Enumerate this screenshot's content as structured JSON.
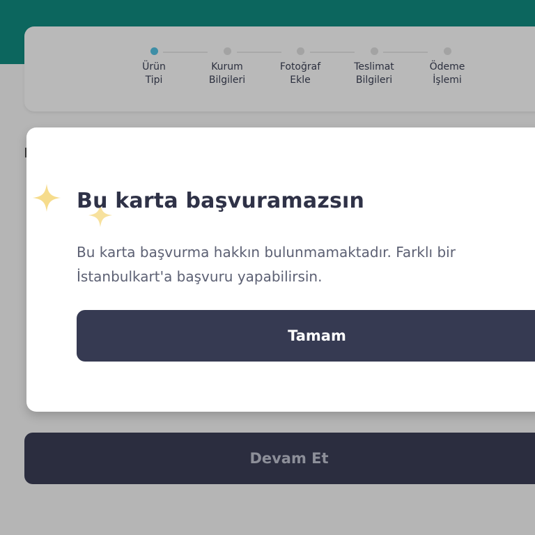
{
  "stepper": {
    "steps": [
      {
        "label": "Ürün\nTipi",
        "active": true
      },
      {
        "label": "Kurum\nBilgileri",
        "active": false
      },
      {
        "label": "Fotoğraf\nEkle",
        "active": false
      },
      {
        "label": "Teslimat\nBilgileri",
        "active": false
      },
      {
        "label": "Ödeme\nİşlemi",
        "active": false
      }
    ]
  },
  "modal": {
    "title": "Bu karta başvuramazsın",
    "message": "Bu karta başvurma hakkın bulunmamaktadır. Farklı bir İstanbulkart'a başvuru yapabilirsin.",
    "ok_label": "Tamam"
  },
  "footer": {
    "continue_label": "Devam Et"
  },
  "colors": {
    "brand_teal": "#0c665e",
    "active_step": "#3e8ea6",
    "primary_button": "#363a52",
    "sparkle": "#f6dc8c"
  }
}
